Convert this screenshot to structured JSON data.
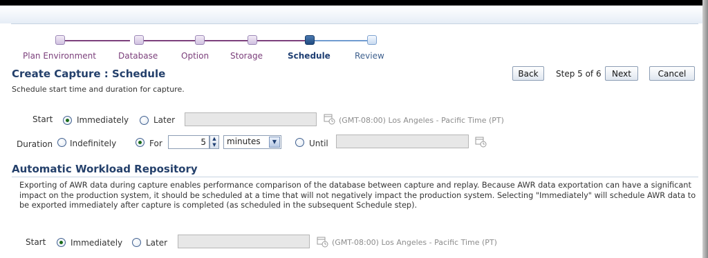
{
  "train": {
    "steps": [
      {
        "label": "Plan Environment",
        "state": "done"
      },
      {
        "label": "Database",
        "state": "done"
      },
      {
        "label": "Option",
        "state": "done"
      },
      {
        "label": "Storage",
        "state": "done"
      },
      {
        "label": "Schedule",
        "state": "current"
      },
      {
        "label": "Review",
        "state": "todo"
      }
    ]
  },
  "page": {
    "title": "Create Capture : Schedule",
    "description": "Schedule start time and duration for capture."
  },
  "nav": {
    "back_label": "Back",
    "step_text": "Step 5 of 6",
    "next_label": "Next",
    "cancel_label": "Cancel"
  },
  "capture_schedule": {
    "start_label": "Start",
    "immediately_label": "Immediately",
    "later_label": "Later",
    "start_selected": "Immediately",
    "later_value": "",
    "timezone": "(GMT-08:00) Los Angeles - Pacific Time (PT)",
    "duration_label": "Duration",
    "indefinitely_label": "Indefinitely",
    "for_label": "For",
    "duration_selected": "For",
    "for_value": "5",
    "unit_value": "minutes",
    "until_label": "Until",
    "until_value": ""
  },
  "awr": {
    "title": "Automatic Workload Repository",
    "description": "Exporting of AWR data during capture enables performance comparison of the database between capture and replay. Because AWR data exportation can have a significant impact on the production system, it should be scheduled at a time that will not negatively impact the production system. Selecting \"Immediately\" will schedule AWR data to be exported immediately after capture is completed (as scheduled in the subsequent Schedule step).",
    "start_label": "Start",
    "immediately_label": "Immediately",
    "later_label": "Later",
    "start_selected": "Immediately",
    "later_value": "",
    "timezone": "(GMT-08:00) Los Angeles - Pacific Time (PT)"
  },
  "icons": {
    "calendar": "calendar-icon",
    "spinner": "spinner-icon",
    "dropdown": "chevron-down-icon"
  }
}
